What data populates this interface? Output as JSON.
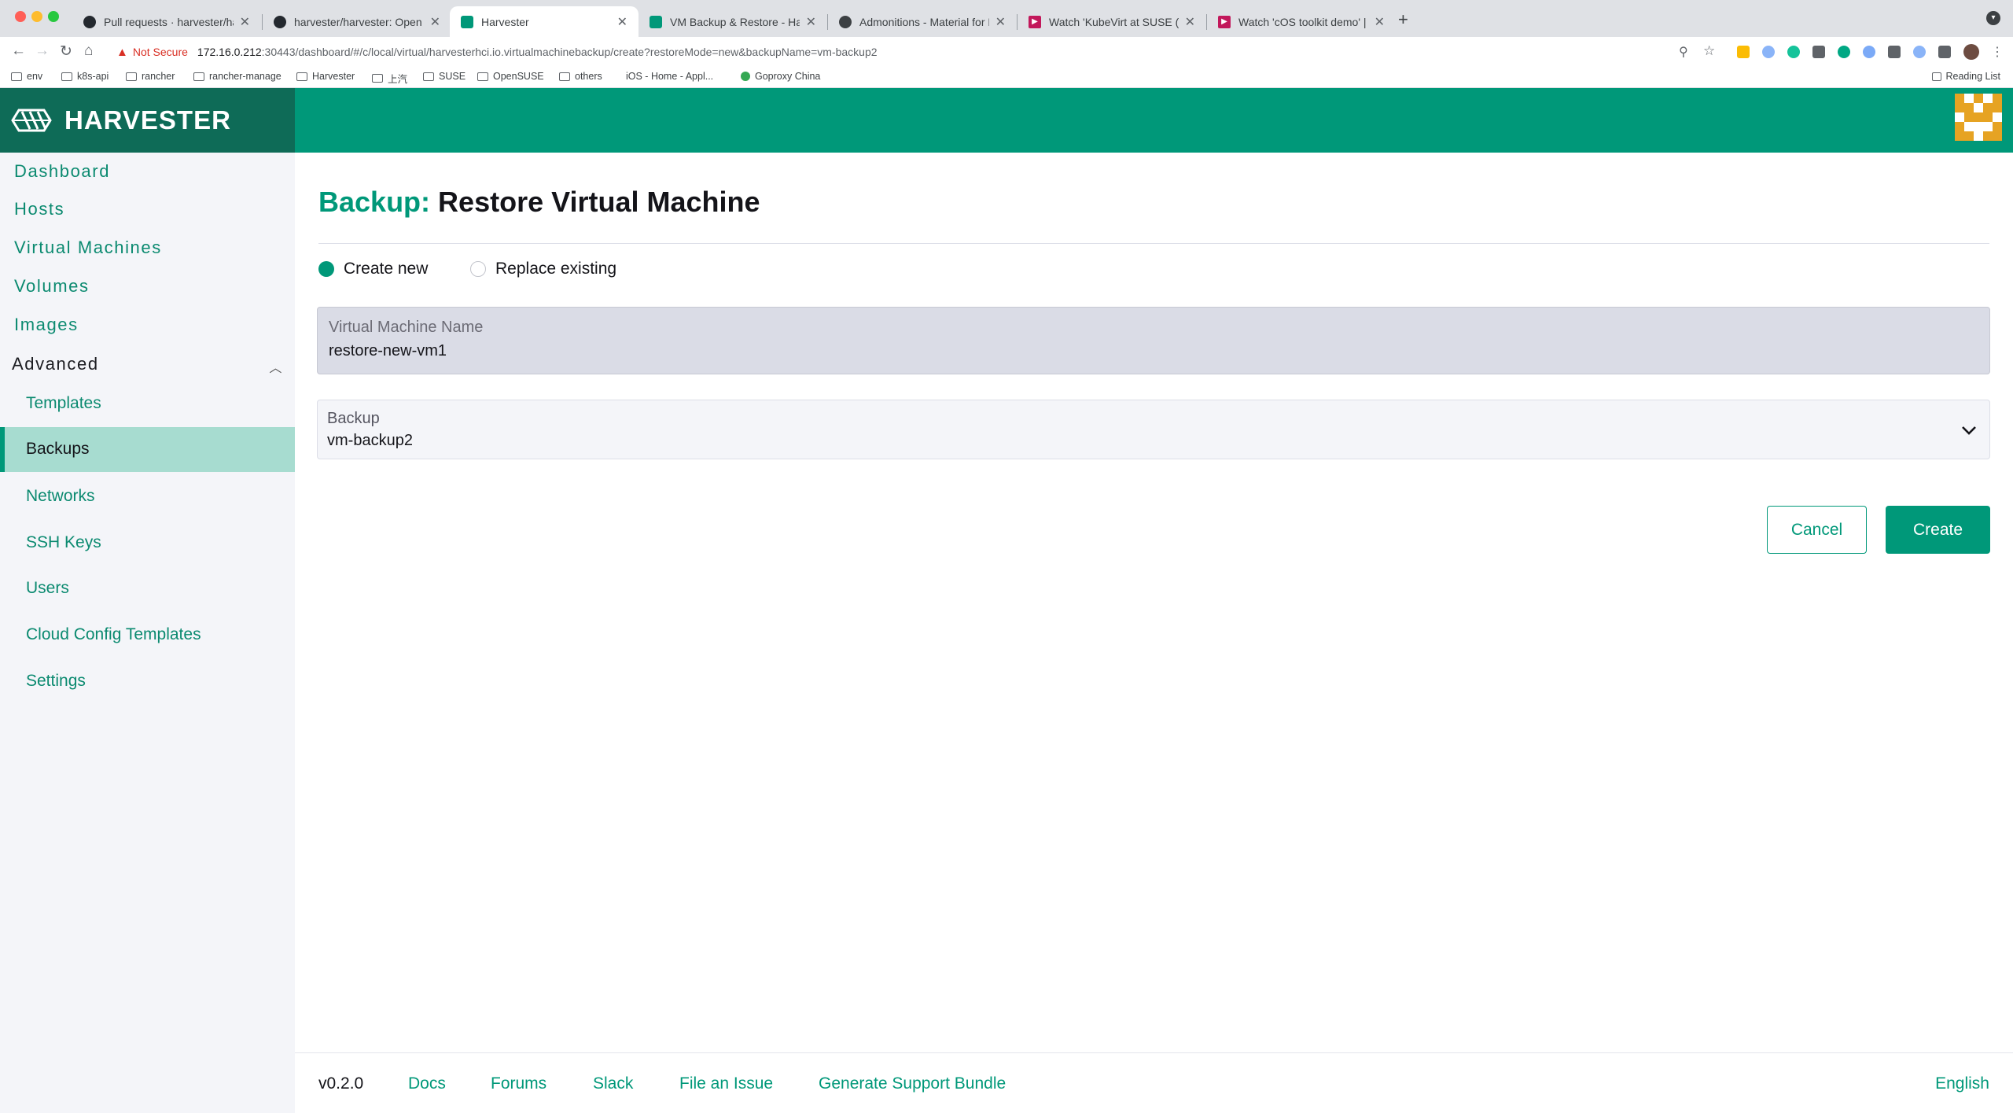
{
  "browser": {
    "tabs": [
      {
        "title": "Pull requests · harvester/harve",
        "icon": "github-icon"
      },
      {
        "title": "harvester/harvester: Open sou",
        "icon": "github-icon"
      },
      {
        "title": "Harvester",
        "icon": "harvester-icon",
        "active": true
      },
      {
        "title": "VM Backup & Restore - Harve",
        "icon": "harvester-icon"
      },
      {
        "title": "Admonitions - Material for MkD",
        "icon": "mkdocs-icon"
      },
      {
        "title": "Watch 'KubeVirt at SUSE (Jim",
        "icon": "play-icon"
      },
      {
        "title": "Watch 'cOS toolkit demo' | Mic",
        "icon": "play-icon"
      }
    ],
    "not_secure_label": "Not Secure",
    "url_host": "172.16.0.212",
    "url_rest": ":30443/dashboard/#/c/local/virtual/harvesterhci.io.virtualmachinebackup/create?restoreMode=new&backupName=vm-backup2",
    "bookmarks": [
      "env",
      "k8s-api",
      "rancher",
      "rancher-manage",
      "Harvester",
      "上汽",
      "SUSE",
      "OpenSUSE",
      "others",
      "iOS - Home - Appl...",
      "Goproxy China"
    ],
    "reading_list": "Reading List"
  },
  "app": {
    "brand": "HARVESTER",
    "colors": {
      "primary": "#009879",
      "brand_dark": "#0e6b57",
      "active_nav": "#a7dcd0"
    }
  },
  "sidebar": {
    "top_items": [
      "Dashboard",
      "Hosts",
      "Virtual Machines",
      "Volumes",
      "Images"
    ],
    "advanced_label": "Advanced",
    "sub_items": [
      "Templates",
      "Backups",
      "Networks",
      "SSH Keys",
      "Users",
      "Cloud Config Templates",
      "Settings"
    ],
    "active_item": "Backups"
  },
  "page": {
    "title_key": "Backup:",
    "title_value": "Restore Virtual Machine",
    "restore_mode": {
      "create_new": "Create new",
      "replace_existing": "Replace existing",
      "selected": "create_new"
    },
    "vm_name": {
      "label": "Virtual Machine Name",
      "value": "restore-new-vm1"
    },
    "backup": {
      "label": "Backup",
      "value": "vm-backup2"
    },
    "cancel_label": "Cancel",
    "create_label": "Create"
  },
  "footer": {
    "version": "v0.2.0",
    "links": [
      "Docs",
      "Forums",
      "Slack",
      "File an Issue",
      "Generate Support Bundle"
    ],
    "language": "English"
  }
}
